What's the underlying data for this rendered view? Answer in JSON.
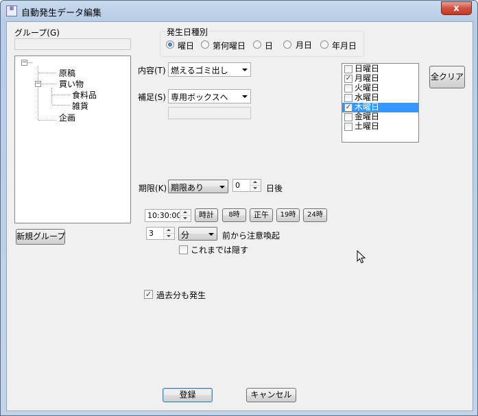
{
  "window": {
    "title": "自動発生データ編集",
    "close_label": "x",
    "icon": "app-calendar-icon"
  },
  "group": {
    "label": "グループ(G)",
    "new_group_button": "新規グループ",
    "tree_root_label": "",
    "tree": [
      {
        "label": "原稿"
      },
      {
        "label": "買い物",
        "children": [
          {
            "label": "食料品"
          },
          {
            "label": "雑貨"
          }
        ]
      },
      {
        "label": "企画"
      }
    ]
  },
  "occurrence_type": {
    "label": "発生日種別",
    "options": [
      "曜日",
      "第何曜日",
      "日",
      "月日",
      "年月日"
    ],
    "selected": "曜日"
  },
  "content": {
    "label": "内容(T)",
    "value": "燃えるゴミ出し"
  },
  "supplement": {
    "label": "補足(S)",
    "value": "専用ボックスへ"
  },
  "weekdays": {
    "items": [
      {
        "label": "日曜日",
        "checked": false
      },
      {
        "label": "月曜日",
        "checked": true
      },
      {
        "label": "火曜日",
        "checked": false
      },
      {
        "label": "水曜日",
        "checked": false
      },
      {
        "label": "木曜日",
        "checked": true,
        "selected": true
      },
      {
        "label": "金曜日",
        "checked": false
      },
      {
        "label": "土曜日",
        "checked": false
      }
    ],
    "clear_all_button": "全クリア"
  },
  "deadline": {
    "label": "期限(K)",
    "mode_value": "期限あり",
    "days_value": "0",
    "days_suffix": "日後"
  },
  "time": {
    "value": "10:30:00",
    "buttons": [
      "時計",
      "8時",
      "正午",
      "19時",
      "24時"
    ]
  },
  "alert": {
    "amount": "3",
    "unit": "分",
    "suffix": "前から注意喚起",
    "hide_until_label": "これまでは隠す",
    "hide_until_checked": false
  },
  "past": {
    "label": "過去分も発生",
    "checked": true
  },
  "footer": {
    "register_button": "登録",
    "cancel_button": "キャンセル"
  }
}
